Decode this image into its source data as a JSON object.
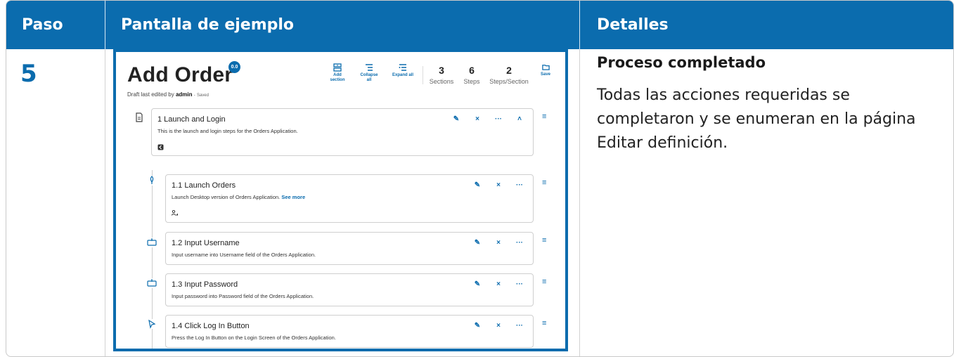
{
  "header": {
    "col1": "Paso",
    "col2": "Pantalla de ejemplo",
    "col3": "Detalles"
  },
  "row": {
    "step": "5",
    "details_title": "Proceso completado",
    "details_body": "Todas las acciones requeridas se completaron y se enumeran en la página Editar definición."
  },
  "screenshot": {
    "title": "Add Order",
    "badge": "0.0",
    "draft_prefix": "Draft last edited by",
    "draft_user": "admin",
    "draft_sep": "-",
    "draft_status": "Saved",
    "toolbar": {
      "add_section": "Add section",
      "collapse_all": "Collapse all",
      "expand_all": "Expand all",
      "save": "Save"
    },
    "stats": [
      {
        "value": "3",
        "label": "Sections"
      },
      {
        "value": "6",
        "label": "Steps"
      },
      {
        "value": "2",
        "label": "Steps/Section"
      }
    ],
    "section": {
      "title": "1 Launch and Login",
      "desc": "This is the launch and login steps for the Orders Application."
    },
    "steps": [
      {
        "title": "1.1 Launch Orders",
        "desc": "Launch Desktop version of Orders Application.",
        "more": "See more",
        "icon": "launch-icon"
      },
      {
        "title": "1.2 Input Username",
        "desc": "Input username into Username field of the Orders Application.",
        "icon": "input-icon"
      },
      {
        "title": "1.3 Input Password",
        "desc": "Input password into Password field of the Orders Application.",
        "icon": "input-icon"
      },
      {
        "title": "1.4 Click Log In Button",
        "desc": "Press the Log In Button on the Login Screen of the Orders Application.",
        "icon": "click-icon"
      }
    ],
    "actions": {
      "edit": "✎",
      "delete": "×",
      "more": "···",
      "collapse": "˄",
      "reorder": "≡"
    }
  },
  "colors": {
    "header_bg": "#0b6cae",
    "accent": "#0b6cae",
    "text": "#222222"
  }
}
